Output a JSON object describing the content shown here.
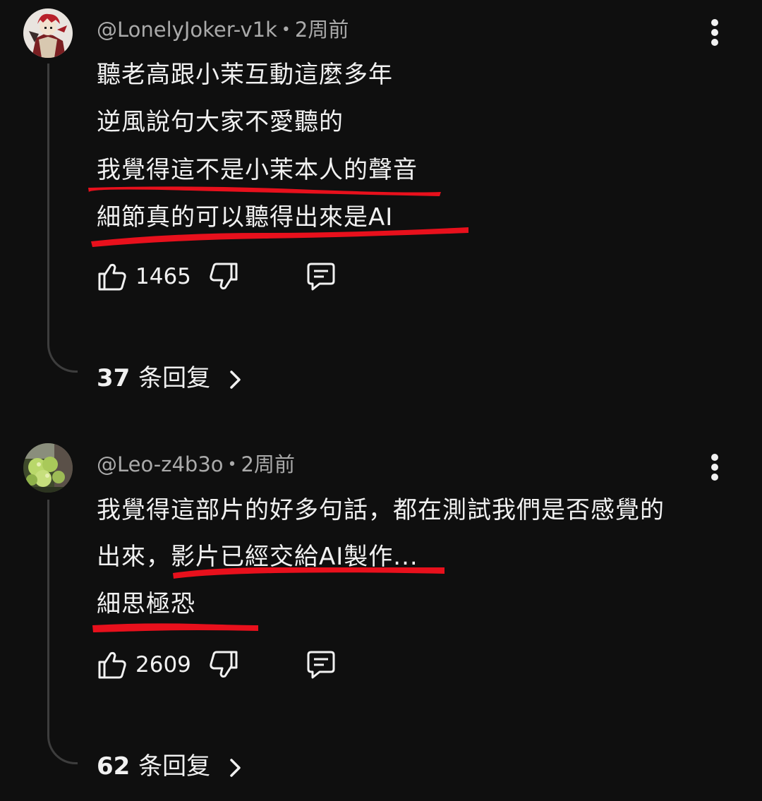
{
  "comments": [
    {
      "author": "@LonelyJoker-v1k",
      "time": "2周前",
      "lines": [
        "聽老高跟小茉互動這麼多年",
        "逆風說句大家不愛聽的",
        "我覺得這不是小茉本人的聲音",
        "細節真的可以聽得出來是AI"
      ],
      "likes": "1465",
      "replies_count": "37",
      "replies_label": "条回复",
      "avatar_icon": "joker-avatar",
      "accent_color": "#e8101c"
    },
    {
      "author": "@Leo-z4b3o",
      "time": "2周前",
      "lines": [
        "我覺得這部片的好多句話，都在測試我們是否感覺的",
        "出來，影片已經交給AI製作...",
        "細思極恐"
      ],
      "likes": "2609",
      "replies_count": "62",
      "replies_label": "条回复",
      "avatar_icon": "hydrangea-avatar",
      "accent_color": "#e8101c"
    }
  ],
  "icons": {
    "like": "thumb-up-icon",
    "dislike": "thumb-down-icon",
    "reply": "comment-icon",
    "more": "more-vertical-icon",
    "replies_chevron": "chevron-right-icon"
  },
  "colors": {
    "background": "#0f0f0f",
    "text": "#f1f1f1",
    "meta": "#aaaaaa",
    "thread": "#3d3d3d",
    "annotation": "#e8101c"
  }
}
